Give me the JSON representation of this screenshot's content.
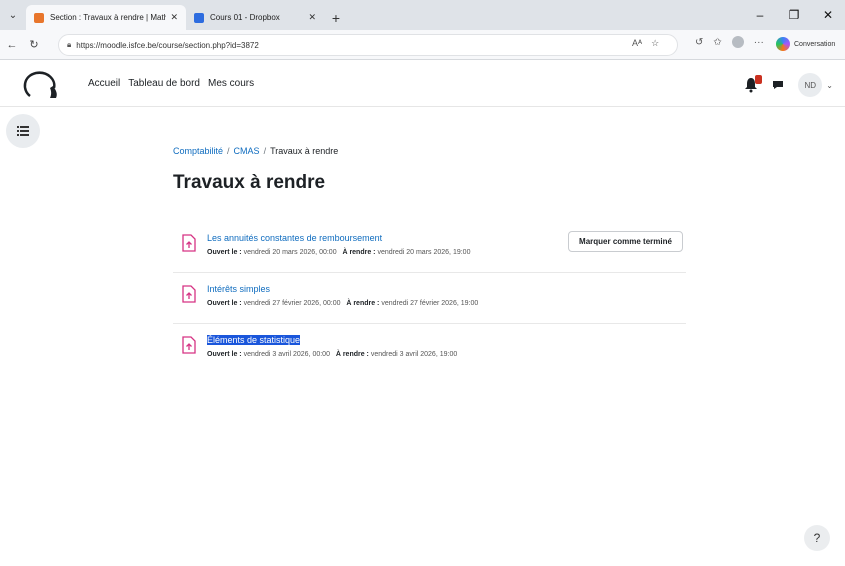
{
  "browser": {
    "tabs": [
      {
        "title": "Section : Travaux à rendre | Mathé",
        "active": true,
        "favicon_color": "#e8762c"
      },
      {
        "title": "Cours 01 - Dropbox",
        "active": false,
        "favicon_color": "#2d6cdf"
      }
    ],
    "url": "https://moodle.isfce.be/course/section.php?id=3872",
    "copilot_label": "Conversation"
  },
  "navbar": {
    "links": [
      "Accueil",
      "Tableau de bord",
      "Mes cours"
    ],
    "notification_count": "",
    "user_initials": "ND"
  },
  "breadcrumb": {
    "items": [
      "Comptabilité",
      "CMAS",
      "Travaux à rendre"
    ],
    "separator": "/"
  },
  "page": {
    "title": "Travaux à rendre"
  },
  "activities": [
    {
      "name": "Les annuités constantes de remboursement",
      "opens_label": "Ouvert le :",
      "opens": "vendredi 20 mars 2026, 00:00",
      "due_label": "À rendre :",
      "due": "vendredi 20 mars 2026, 19:00",
      "button": "Marquer comme terminé"
    },
    {
      "name": "Intérêts simples",
      "opens_label": "Ouvert le :",
      "opens": "vendredi 27 février 2026, 00:00",
      "due_label": "À rendre :",
      "due": "vendredi 27 février 2026, 19:00"
    },
    {
      "name": "Éléments de statistique",
      "opens_label": "Ouvert le :",
      "opens": "vendredi 3 avril 2026, 00:00",
      "due_label": "À rendre :",
      "due": "vendredi 3 avril 2026, 19:00"
    }
  ],
  "help": {
    "label": "?"
  },
  "colors": {
    "link": "#0f6cbf",
    "assignment_icon": "#d63384",
    "selection": "#1a56db"
  }
}
